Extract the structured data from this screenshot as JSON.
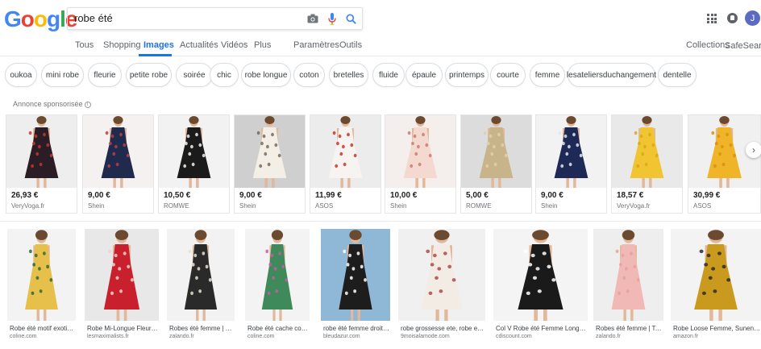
{
  "header": {
    "logo_letters": [
      "G",
      "o",
      "o",
      "g",
      "l",
      "e"
    ],
    "search_value": "robe été",
    "avatar_initial": "J"
  },
  "tabs": [
    {
      "label": "Tous",
      "active": false
    },
    {
      "label": "Shopping",
      "active": false
    },
    {
      "label": "Images",
      "active": true
    },
    {
      "label": "Actualités",
      "active": false
    },
    {
      "label": "Vidéos",
      "active": false
    },
    {
      "label": "Plus",
      "active": false
    },
    {
      "label": "Paramètres",
      "active": false
    },
    {
      "label": "Outils",
      "active": false
    }
  ],
  "header_right": {
    "collections": "Collections",
    "safesearch": "SafeSearch ▾"
  },
  "chips": [
    "oukoa",
    "mini robe",
    "fleurie",
    "petite robe",
    "soirée",
    "chic",
    "robe longue",
    "coton",
    "bretelles",
    "fluide",
    "épaule",
    "printemps",
    "courte",
    "femme",
    "lesateliersduchangement",
    "dentelle"
  ],
  "sponsored_label": "Annonce sponsorisée",
  "sponsored_info": "i",
  "next_arrow": "›",
  "products": [
    {
      "price": "26,93 €",
      "store": "VeryVoga.fr",
      "bg": "#eeeeee",
      "dress": "#2b1d26",
      "accent": "#c0392b"
    },
    {
      "price": "9,00 €",
      "store": "Shein",
      "bg": "#f4f1f0",
      "dress": "#1f2a4d",
      "accent": "#b5404a"
    },
    {
      "price": "10,50 €",
      "store": "ROMWE",
      "bg": "#f2f2f2",
      "dress": "#1b1b1b",
      "accent": "#f3f0e8"
    },
    {
      "price": "9,00 €",
      "store": "Shein",
      "bg": "#cfcfcf",
      "dress": "#f3eee6",
      "accent": "#7a6a5a"
    },
    {
      "price": "11,99 €",
      "store": "ASOS",
      "bg": "#ececec",
      "dress": "#f7f3f1",
      "accent": "#c0392b"
    },
    {
      "price": "10,00 €",
      "store": "Shein",
      "bg": "#f4efec",
      "dress": "#f3d9cf",
      "accent": "#c97d6e"
    },
    {
      "price": "5,00 €",
      "store": "ROMWE",
      "bg": "#dcdcdc",
      "dress": "#c8b48a",
      "accent": "#e0d0a8"
    },
    {
      "price": "9,00 €",
      "store": "Shein",
      "bg": "#f2f2f2",
      "dress": "#1e2a55",
      "accent": "#e5e5f0"
    },
    {
      "price": "18,57 €",
      "store": "VeryVoga.fr",
      "bg": "#e9e9e9",
      "dress": "#f1c431",
      "accent": "#d9a81a"
    },
    {
      "price": "30,99 €",
      "store": "ASOS",
      "bg": "#f0f0f0",
      "dress": "#f0b429",
      "accent": "#d98f12"
    }
  ],
  "images": [
    {
      "title": "Robe été motif exotique...",
      "source": "coline.com",
      "bg": "#f3f3f3",
      "dress": "#e6c04a",
      "accent": "#2c6b3c"
    },
    {
      "title": "Robe Mi-Longue Fleurie...",
      "source": "lesmaximalists.fr",
      "bg": "#e8e8e8",
      "dress": "#c8202c",
      "accent": "#f2d0d0"
    },
    {
      "title": "Robes été femme | To...",
      "source": "zalando.fr",
      "bg": "#f2f2f2",
      "dress": "#2a2a2a",
      "accent": "#e8e0d0"
    },
    {
      "title": "Robe été cache coeur...",
      "source": "coline.com",
      "bg": "#f3f3f3",
      "dress": "#3f8a5a",
      "accent": "#c85aa8"
    },
    {
      "title": "robe été femme droite...",
      "source": "bleudazur.com",
      "bg": "#8fb7d6",
      "dress": "#1d1d1d",
      "accent": "#ffffff"
    },
    {
      "title": "robe grossesse ete, robe ete...",
      "source": "9moisalamode.com",
      "bg": "#f0f0f0",
      "dress": "#f2ece4",
      "accent": "#b04a4a"
    },
    {
      "title": "Col V Robe été Femme Longue...",
      "source": "cdiscount.com",
      "bg": "#f4f4f4",
      "dress": "#1a1a1a",
      "accent": "#ffffff"
    },
    {
      "title": "Robes été femme | To...",
      "source": "zalando.fr",
      "bg": "#eeeeee",
      "dress": "#f1b9b5",
      "accent": "#e8a09c"
    },
    {
      "title": "Robe Loose Femme, Sunenjoy ...",
      "source": "amazon.fr",
      "bg": "#f3f3f3",
      "dress": "#c99a1e",
      "accent": "#2b2b2b"
    }
  ]
}
